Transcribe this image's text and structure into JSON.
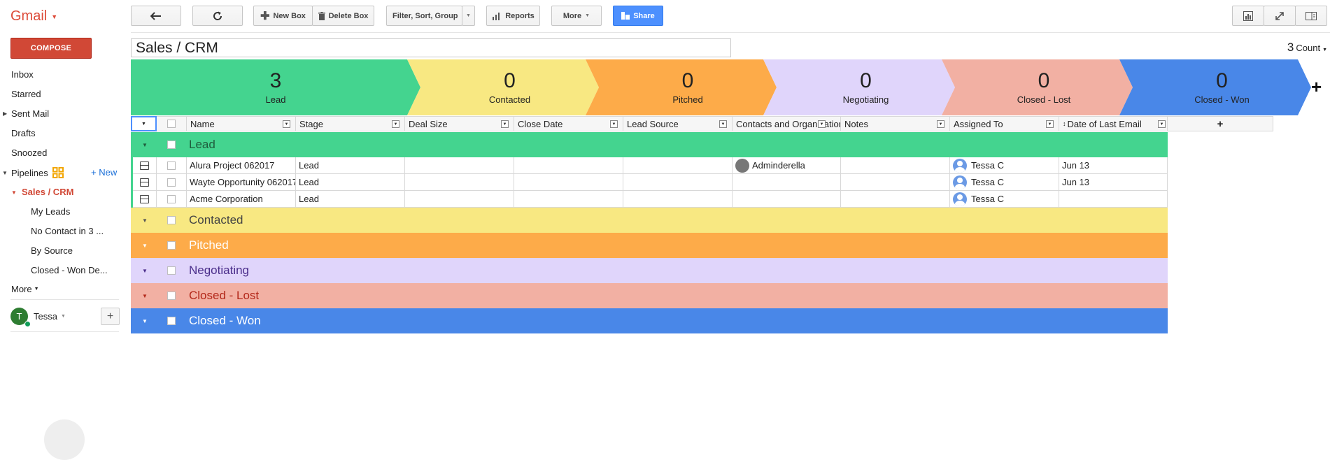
{
  "app": {
    "logo": "Gmail"
  },
  "toolbar": {
    "new_box": "New Box",
    "delete_box": "Delete Box",
    "filter": "Filter, Sort, Group",
    "reports": "Reports",
    "more": "More",
    "share": "Share"
  },
  "sidebar": {
    "compose": "COMPOSE",
    "items": [
      "Inbox",
      "Starred",
      "Sent Mail",
      "Drafts",
      "Snoozed"
    ],
    "pipelines": "Pipelines",
    "new_link": "+ New",
    "pipeline": "Sales / CRM",
    "views": [
      "My Leads",
      "No Contact in 3 ...",
      "By Source",
      "Closed - Won De..."
    ],
    "more": "More",
    "user": "Tessa",
    "avatar_letter": "T"
  },
  "pipeline": {
    "title": "Sales / CRM",
    "count": "3",
    "count_label": "Count"
  },
  "stages": [
    {
      "name": "Lead",
      "count": "3",
      "bg": "#44d48f",
      "fg": "#1f5c3c"
    },
    {
      "name": "Contacted",
      "count": "0",
      "bg": "#f8e882",
      "fg": "#555555"
    },
    {
      "name": "Pitched",
      "count": "0",
      "bg": "#fdab49",
      "fg": "#ffffff"
    },
    {
      "name": "Negotiating",
      "count": "0",
      "bg": "#e0d5fb",
      "fg": "#4a2d8a"
    },
    {
      "name": "Closed - Lost",
      "count": "0",
      "bg": "#f2b0a3",
      "fg": "#b3281a"
    },
    {
      "name": "Closed - Won",
      "count": "0",
      "bg": "#4987e8",
      "fg": "#ffffff"
    }
  ],
  "columns": [
    "Name",
    "Stage",
    "Deal Size",
    "Close Date",
    "Lead Source",
    "Contacts and Organizations",
    "Notes",
    "Assigned To",
    "Date of Last Email"
  ],
  "groups": [
    "Lead",
    "Contacted",
    "Pitched",
    "Negotiating",
    "Closed - Lost",
    "Closed - Won"
  ],
  "rows": [
    {
      "name": "Alura Project 062017",
      "stage": "Lead",
      "contact": "Adminderella",
      "assigned": "Tessa C",
      "last_email": "Jun 13"
    },
    {
      "name": "Wayte Opportunity 062017",
      "stage": "Lead",
      "contact": "",
      "assigned": "Tessa C",
      "last_email": "Jun 13"
    },
    {
      "name": "Acme Corporation",
      "stage": "Lead",
      "contact": "",
      "assigned": "Tessa C",
      "last_email": ""
    }
  ]
}
